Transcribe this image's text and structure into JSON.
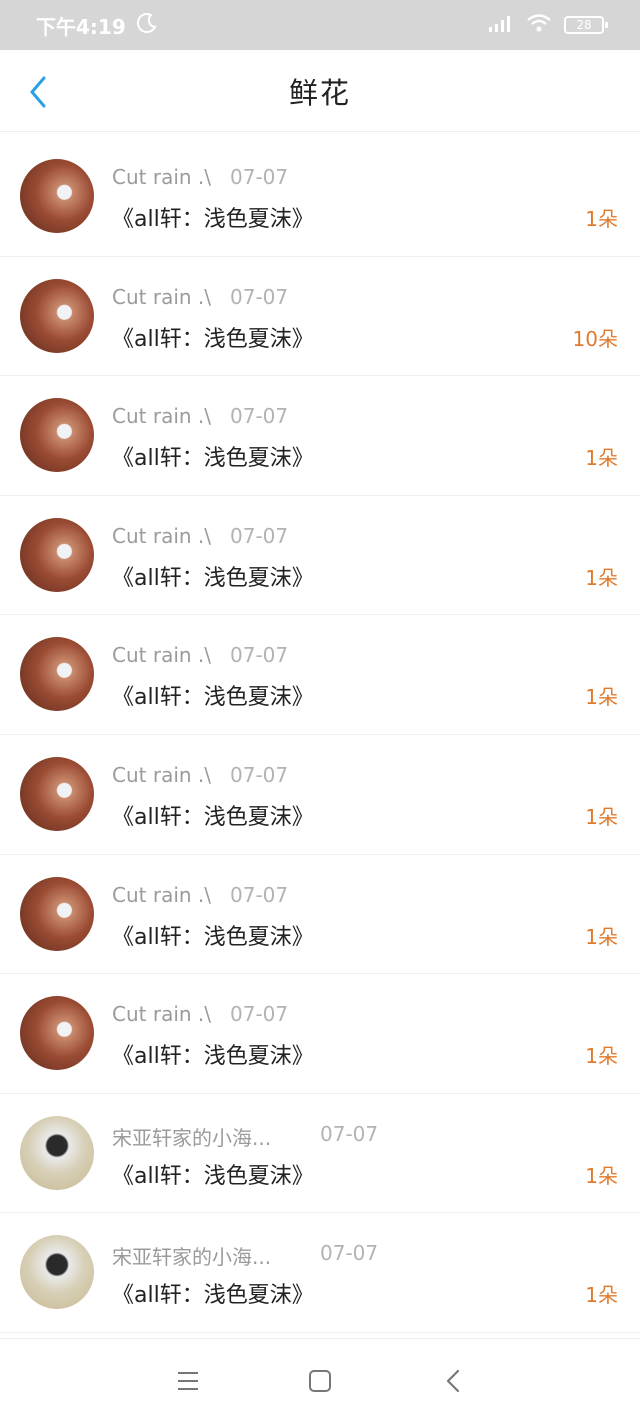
{
  "status_bar": {
    "time": "下午4:19",
    "battery": "28",
    "icons": [
      "moon-icon",
      "signal-icon",
      "wifi-icon",
      "battery-icon"
    ]
  },
  "header": {
    "title": "鲜花",
    "back_icon": "chevron-left-icon"
  },
  "colors": {
    "accent": "#2b9fe6",
    "count": "#e07b2e",
    "meta": "#9b9b9b",
    "status_bar": "#d6d6d6"
  },
  "rows": [
    {
      "name": "Cut rain .\\",
      "date": "07-07",
      "title": "《all轩：浅色夏沫》",
      "count": "1朵",
      "avatar": "avatar-1"
    },
    {
      "name": "Cut rain .\\",
      "date": "07-07",
      "title": "《all轩：浅色夏沫》",
      "count": "10朵",
      "avatar": "avatar-1"
    },
    {
      "name": "Cut rain .\\",
      "date": "07-07",
      "title": "《all轩：浅色夏沫》",
      "count": "1朵",
      "avatar": "avatar-1"
    },
    {
      "name": "Cut rain .\\",
      "date": "07-07",
      "title": "《all轩：浅色夏沫》",
      "count": "1朵",
      "avatar": "avatar-1"
    },
    {
      "name": "Cut rain .\\",
      "date": "07-07",
      "title": "《all轩：浅色夏沫》",
      "count": "1朵",
      "avatar": "avatar-1"
    },
    {
      "name": "Cut rain .\\",
      "date": "07-07",
      "title": "《all轩：浅色夏沫》",
      "count": "1朵",
      "avatar": "avatar-1"
    },
    {
      "name": "Cut rain .\\",
      "date": "07-07",
      "title": "《all轩：浅色夏沫》",
      "count": "1朵",
      "avatar": "avatar-1"
    },
    {
      "name": "Cut rain .\\",
      "date": "07-07",
      "title": "《all轩：浅色夏沫》",
      "count": "1朵",
      "avatar": "avatar-1"
    },
    {
      "name": "宋亚轩家的小海...",
      "date": "07-07",
      "title": "《all轩：浅色夏沫》",
      "count": "1朵",
      "avatar": "avatar-2"
    },
    {
      "name": "宋亚轩家的小海...",
      "date": "07-07",
      "title": "《all轩：浅色夏沫》",
      "count": "1朵",
      "avatar": "avatar-2"
    }
  ],
  "nav_bar": {
    "icons": [
      "menu-icon",
      "home-square-icon",
      "back-chevron-icon"
    ]
  }
}
